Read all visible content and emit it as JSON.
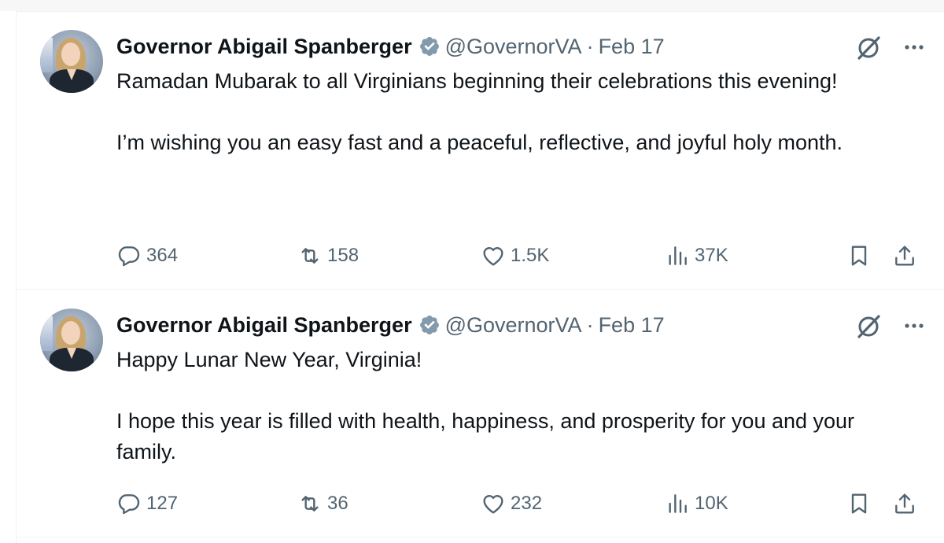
{
  "tweets": [
    {
      "author_name": "Governor Abigail Spanberger",
      "handle": "@GovernorVA",
      "separator": "·",
      "date": "Feb 17",
      "paragraphs": [
        "Ramadan Mubarak to all Virginians beginning their celebrations this evening!",
        "I’m wishing you an easy fast and a peaceful, reflective, and joyful holy month."
      ],
      "stats": {
        "replies": "364",
        "reposts": "158",
        "likes": "1.5K",
        "views": "37K"
      },
      "icons": {
        "verified": "verified-badge-icon",
        "grok": "grok-icon",
        "more": "more-icon",
        "reply": "reply-icon",
        "repost": "repost-icon",
        "like": "heart-icon",
        "views": "views-icon",
        "bookmark": "bookmark-icon",
        "share": "share-icon"
      }
    },
    {
      "author_name": "Governor Abigail Spanberger",
      "handle": "@GovernorVA",
      "separator": "·",
      "date": "Feb 17",
      "paragraphs": [
        "Happy Lunar New Year, Virginia!",
        "I hope this year is filled with health, happiness, and prosperity for you and your family."
      ],
      "stats": {
        "replies": "127",
        "reposts": "36",
        "likes": "232",
        "views": "10K"
      },
      "icons": {
        "verified": "verified-badge-icon",
        "grok": "grok-icon",
        "more": "more-icon",
        "reply": "reply-icon",
        "repost": "repost-icon",
        "like": "heart-icon",
        "views": "views-icon",
        "bookmark": "bookmark-icon",
        "share": "share-icon"
      }
    }
  ],
  "colors": {
    "text_primary": "#0f1419",
    "text_secondary": "#536471",
    "verified_badge": "#829aab",
    "divider": "#eff3f4"
  }
}
